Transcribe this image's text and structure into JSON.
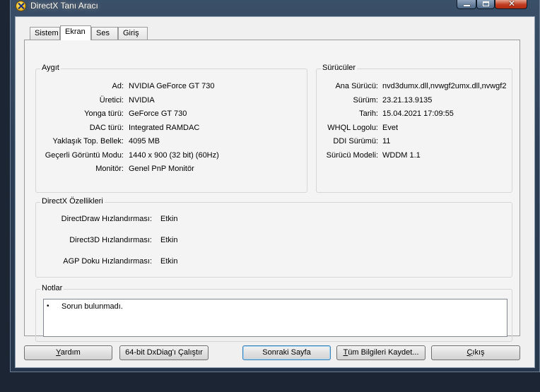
{
  "window": {
    "title": "DirectX Tanı Aracı"
  },
  "tabs": [
    {
      "label": "Sistem",
      "active": false
    },
    {
      "label": "Ekran",
      "active": true
    },
    {
      "label": "Ses",
      "active": false
    },
    {
      "label": "Giriş",
      "active": false
    }
  ],
  "device": {
    "title": "Aygıt",
    "rows": [
      {
        "label": "Ad:",
        "value": "NVIDIA GeForce GT 730"
      },
      {
        "label": "Üretici:",
        "value": "NVIDIA"
      },
      {
        "label": "Yonga türü:",
        "value": "GeForce GT 730"
      },
      {
        "label": "DAC türü:",
        "value": "Integrated RAMDAC"
      },
      {
        "label": "Yaklaşık Top. Bellek:",
        "value": "4095 MB"
      },
      {
        "label": "Geçerli Görüntü Modu:",
        "value": "1440 x 900 (32 bit) (60Hz)"
      },
      {
        "label": "Monitör:",
        "value": "Genel PnP Monitör"
      }
    ]
  },
  "drivers": {
    "title": "Sürücüler",
    "rows": [
      {
        "label": "Ana Sürücü:",
        "value": "nvd3dumx.dll,nvwgf2umx.dll,nvwgf2"
      },
      {
        "label": "Sürüm:",
        "value": "23.21.13.9135"
      },
      {
        "label": "Tarih:",
        "value": "15.04.2021 17:09:55"
      },
      {
        "label": "WHQL Logolu:",
        "value": "Evet"
      },
      {
        "label": "DDI Sürümü:",
        "value": "11"
      },
      {
        "label": "Sürücü Modeli:",
        "value": "WDDM 1.1"
      }
    ]
  },
  "features": {
    "title": "DirectX Özellikleri",
    "rows": [
      {
        "label": "DirectDraw Hızlandırması:",
        "value": "Etkin"
      },
      {
        "label": "Direct3D Hızlandırması:",
        "value": "Etkin"
      },
      {
        "label": "AGP Doku Hızlandırması:",
        "value": "Etkin"
      }
    ]
  },
  "notes": {
    "title": "Notlar",
    "bullet": "•",
    "items": [
      "Sorun bulunmadı."
    ]
  },
  "buttons": {
    "help": {
      "mnemonic": "Y",
      "rest": "ardım"
    },
    "run64": "64-bit DxDiag'ı Çalıştır",
    "next": "Sonraki Sayfa",
    "save_all": {
      "mnemonic": "T",
      "rest": "üm Bilgileri Kaydet..."
    },
    "exit": {
      "mnemonic": "Ç",
      "rest": "ıkış"
    }
  },
  "icons": {
    "app": "directx-x-icon",
    "minimize": "minimize-icon",
    "maximize": "maximize-icon",
    "close": "close-icon"
  },
  "colors": {
    "frame": "#2c3e55",
    "close_button": "#c13b1f",
    "default_button_border": "#3c7fb1"
  }
}
